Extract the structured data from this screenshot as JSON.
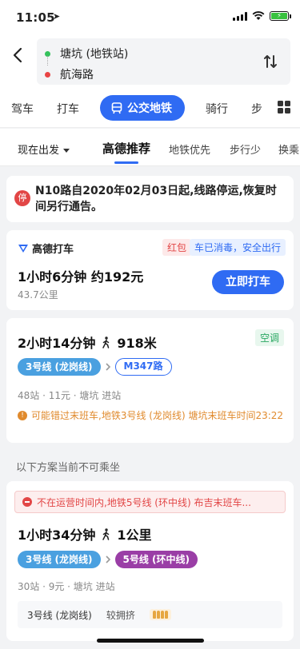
{
  "status": {
    "time": "11:05",
    "battery_color": "#39c23f"
  },
  "route": {
    "origin": "塘坑 (地铁站)",
    "destination": "航海路"
  },
  "tabs": [
    {
      "label": "驾车"
    },
    {
      "label": "打车"
    },
    {
      "label": "公交地铁",
      "active": true
    },
    {
      "label": "骑行"
    },
    {
      "label": "步"
    }
  ],
  "filters": {
    "departure": "现在出发",
    "options": [
      "高德推荐",
      "地铁优先",
      "步行少",
      "换乘"
    ]
  },
  "notice": {
    "badge": "停",
    "text": "N10路自2020年02月03日起,线路停运,恢复时间另行通告。"
  },
  "taxi": {
    "brand": "高德打车",
    "tag_red": "红包",
    "tag_blue": "车已消毒，安全出行",
    "duration_price": "1小时6分钟 约192元",
    "distance": "43.7公里",
    "button": "立即打车"
  },
  "plan1": {
    "duration": "2小时14分钟",
    "walk": "918米",
    "badge": "空调",
    "chips": [
      "3号线 (龙岗线)",
      "M347路"
    ],
    "meta": "48站 · 11元 · 塘坑 进站",
    "warning": "可能错过末班车,地铁3号线 (龙岗线) 塘坑末班车时间23:22"
  },
  "section_title": "以下方案当前不可乘坐",
  "plan2": {
    "banner": "不在运营时间内,地铁5号线 (环中线) 布吉末班车...",
    "duration": "1小时34分钟",
    "walk": "1公里",
    "chips": [
      "3号线 (龙岗线)",
      "5号线 (环中线)"
    ],
    "meta": "30站 · 9元 · 塘坑 进站",
    "crowd_line": "3号线 (龙岗线)",
    "crowd_level": "较拥挤"
  },
  "colors": {
    "accent": "#2f6bf3",
    "line3": "#4aa0e0",
    "line5": "#9a3ea6",
    "warn": "#e08a2d",
    "alert": "#e24646"
  }
}
